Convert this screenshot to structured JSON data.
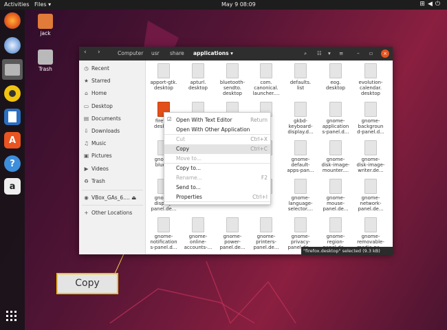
{
  "topbar": {
    "activities": "Activities",
    "app_menu": "Files ▾",
    "clock": "May 9  08:09",
    "tray_icons": [
      "network-icon",
      "volume-icon",
      "power-icon"
    ]
  },
  "dock": {
    "apps": [
      "Firefox",
      "Thunderbird",
      "Files",
      "Rhythmbox",
      "LibreOffice Writer",
      "Ubuntu Software",
      "Help",
      "Amazon"
    ]
  },
  "desktop": {
    "icons": [
      {
        "label": "jack"
      },
      {
        "label": "Trash"
      }
    ]
  },
  "window": {
    "path": [
      "Computer",
      "usr",
      "share",
      "applications"
    ],
    "active_path": "applications ▾",
    "sidebar": [
      {
        "label": "Recent",
        "icon": "clock-icon"
      },
      {
        "label": "Starred",
        "icon": "star-icon"
      },
      {
        "label": "Home",
        "icon": "home-icon"
      },
      {
        "label": "Desktop",
        "icon": "folder-icon"
      },
      {
        "label": "Documents",
        "icon": "documents-icon"
      },
      {
        "label": "Downloads",
        "icon": "download-icon"
      },
      {
        "label": "Music",
        "icon": "music-icon"
      },
      {
        "label": "Pictures",
        "icon": "pictures-icon"
      },
      {
        "label": "Videos",
        "icon": "videos-icon"
      },
      {
        "label": "Trash",
        "icon": "trash-icon"
      },
      {
        "label": "VBox_GAs_6....",
        "icon": "disc-icon"
      },
      {
        "label": "Other Locations",
        "icon": "plus-icon"
      }
    ],
    "files": [
      [
        "apport-gtk.\ndesktop",
        "apturl.\ndesktop",
        "bluetooth-\nsendto.\ndesktop",
        "com.\ncanonical.\nlauncher....",
        "defaults.\nlist",
        "eog.\ndesktop",
        "evolution-\ncalendar.\ndesktop"
      ],
      [
        "firefox.\ndesktop",
        "",
        "",
        "",
        "gkbd-\nkeyboard-\ndisplay.d...",
        "gnome-\napplication\ns-panel.d...",
        "gnome-\nbackgroun\nd-panel.d..."
      ],
      [
        "gnome-\nbluet...",
        "",
        "",
        "",
        "gnome-\ndefault-\napps-pan...",
        "gnome-\ndisk-image-\nmounter....",
        "gnome-\ndisk-image-\nwriter.de..."
      ],
      [
        "gnome-\ndisplay-\npanel.de...",
        "",
        "",
        "",
        "gnome-\nlanguage-\nselector....",
        "gnome-\nmouse-\npanel.de...",
        "gnome-\nnetwork-\npanel.de..."
      ],
      [
        "gnome-\nnotification\ns-panel.d...",
        "gnome-\nonline-\naccounts-...",
        "gnome-\npower-\npanel.de...",
        "gnome-\nprinters-\npanel.de...",
        "gnome-\nprivacy-\npanel.de...",
        "gnome-\nregion-\npanel.de...",
        "gnome-\nremovable-\nmedia-pa..."
      ]
    ],
    "status": "\"firefox.desktop\" selected (9.3 kB)"
  },
  "context_menu": {
    "items": [
      {
        "label": "Open With Text Editor",
        "shortcut": "Return",
        "disabled": false
      },
      {
        "label": "Open With Other Application",
        "shortcut": "",
        "disabled": false
      },
      {
        "label": "Cut",
        "shortcut": "Ctrl+X",
        "disabled": true
      },
      {
        "label": "Copy",
        "shortcut": "Ctrl+C",
        "disabled": false,
        "highlighted": true
      },
      {
        "label": "Move to...",
        "shortcut": "",
        "disabled": true
      },
      {
        "label": "Copy to...",
        "shortcut": "",
        "disabled": false
      },
      {
        "label": "Rename...",
        "shortcut": "F2",
        "disabled": true
      },
      {
        "label": "Send to...",
        "shortcut": "",
        "disabled": false
      },
      {
        "label": "Properties",
        "shortcut": "Ctrl+I",
        "disabled": false
      }
    ]
  },
  "callout": {
    "label": "Copy"
  },
  "colors": {
    "accent": "#f5c400",
    "firefox_file": "#e3501a",
    "close_button": "#e95420"
  }
}
